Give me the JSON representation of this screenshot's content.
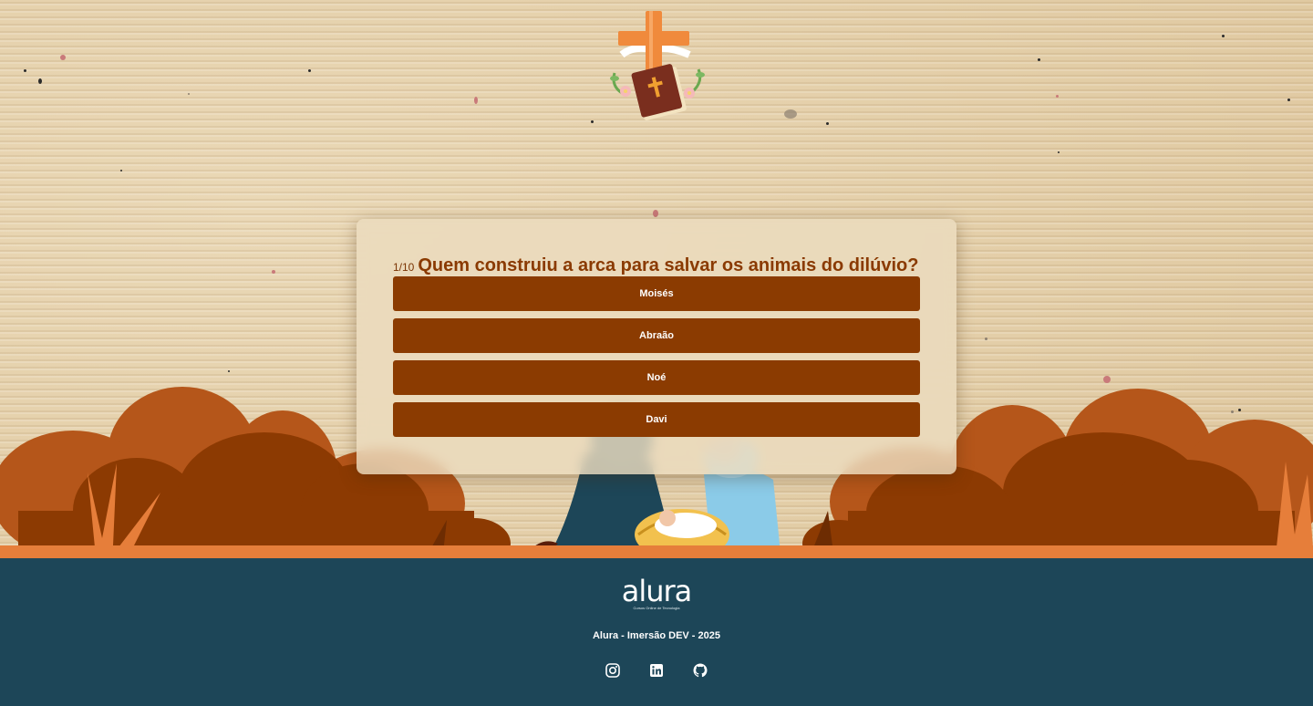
{
  "quiz": {
    "counter": "1/10",
    "question": "Quem construiu a arca para salvar os animais do dilúvio?",
    "answers": [
      {
        "label": "Moisés"
      },
      {
        "label": "Abraão"
      },
      {
        "label": "Noé"
      },
      {
        "label": "Davi"
      }
    ]
  },
  "footer": {
    "logo_text": "alura",
    "logo_tagline": "Cursos Online de Tecnologia",
    "credits": "Alura - Imersão DEV - 2025",
    "social": [
      "instagram-icon",
      "linkedin-icon",
      "github-icon"
    ]
  },
  "colors": {
    "button": "#8b3b01",
    "question": "#8a3a02",
    "footer": "#1d4658",
    "bush_light": "#b5561a",
    "bush_dark": "#8c3a02",
    "ground": "#e67e3a"
  }
}
